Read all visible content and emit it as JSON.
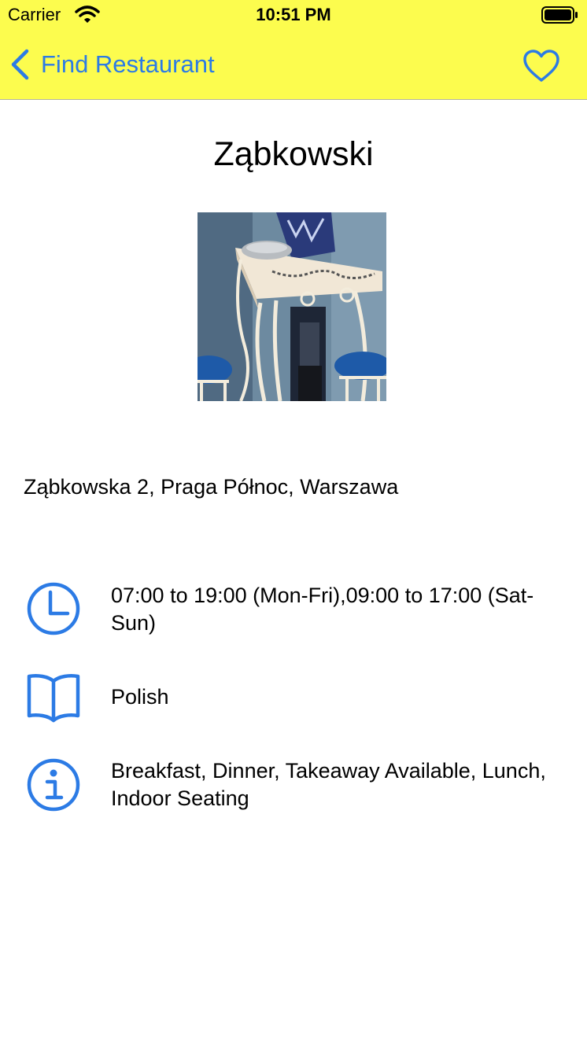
{
  "status_bar": {
    "carrier": "Carrier",
    "time": "10:51 PM",
    "wifi_icon": "wifi-icon",
    "battery_icon": "battery-icon"
  },
  "nav": {
    "back_label": "Find Restaurant",
    "back_icon": "chevron-left-icon",
    "favorite_icon": "heart-icon"
  },
  "colors": {
    "nav_background": "#fcfc4e",
    "accent": "#2c7be5"
  },
  "restaurant": {
    "name": "Ząbkowski",
    "address": "Ząbkowska 2, Praga Północ, Warszawa",
    "photo_icon": "restaurant-photo",
    "details": [
      {
        "icon": "clock-icon",
        "text": "07:00 to 19:00 (Mon-Fri),09:00 to 17:00 (Sat-Sun)"
      },
      {
        "icon": "book-icon",
        "text": "Polish"
      },
      {
        "icon": "info-icon",
        "text": "Breakfast, Dinner, Takeaway Available, Lunch, Indoor Seating"
      }
    ]
  }
}
